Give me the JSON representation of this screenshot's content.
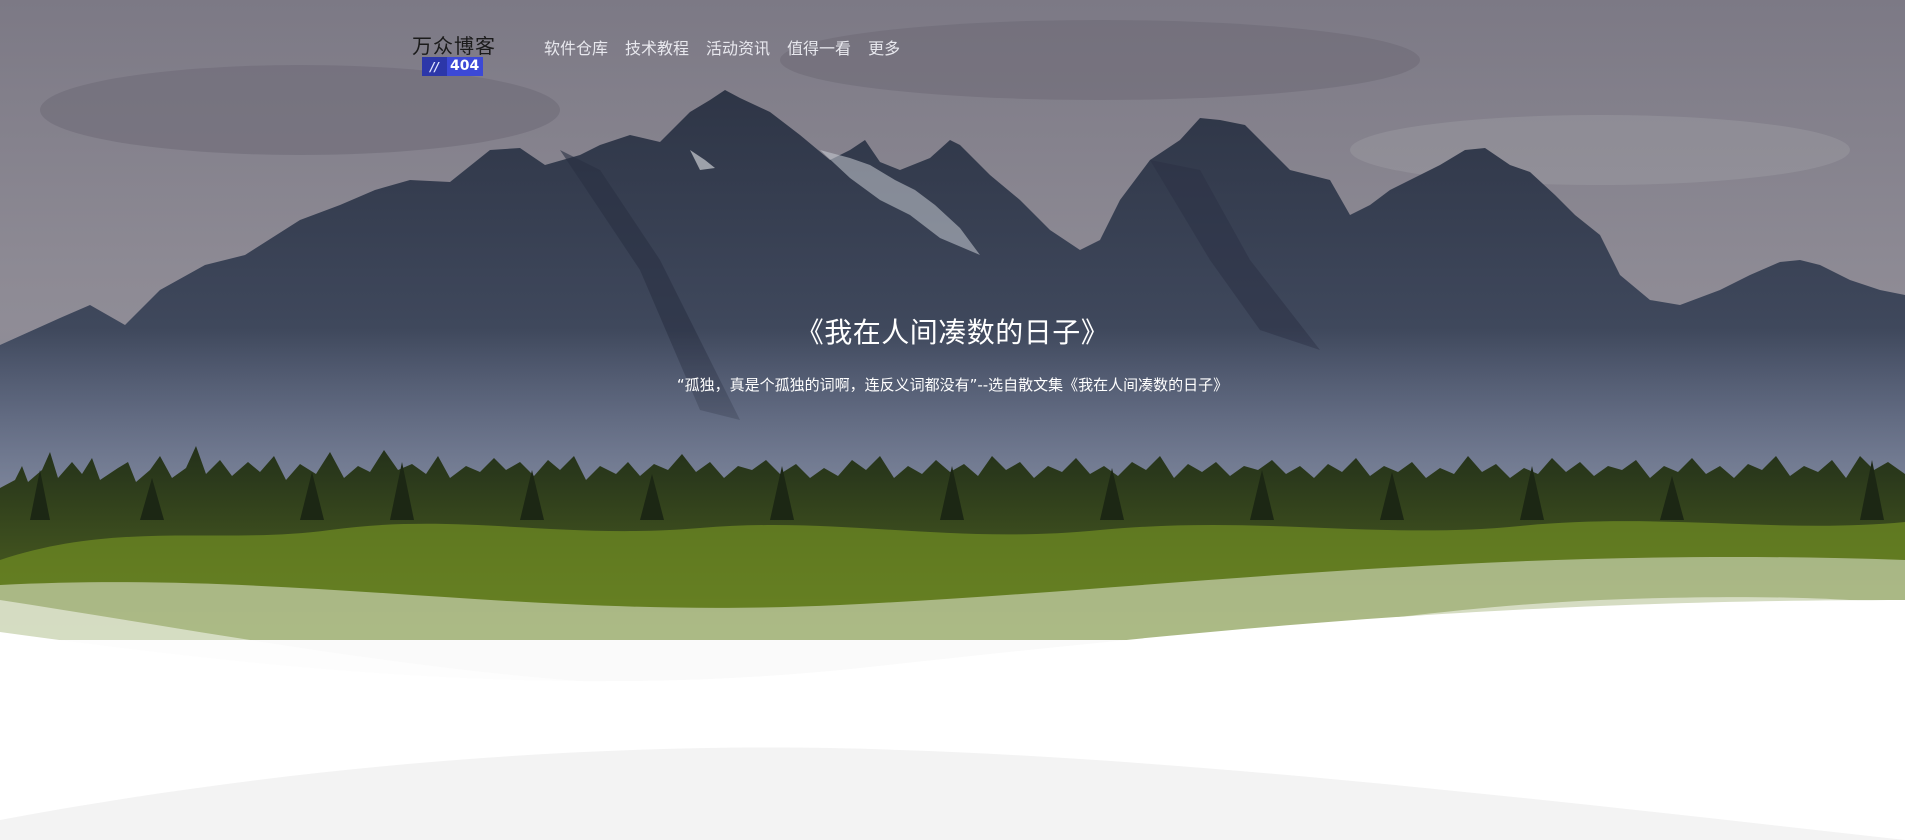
{
  "site": {
    "logo_title": "万众博客",
    "logo_badge_slash": "//",
    "logo_badge_code": "404"
  },
  "nav": {
    "items": [
      {
        "label": "软件仓库"
      },
      {
        "label": "技术教程"
      },
      {
        "label": "活动资讯"
      },
      {
        "label": "值得一看"
      },
      {
        "label": "更多"
      }
    ]
  },
  "hero": {
    "headline": "《我在人间凑数的日子》",
    "quote": "“孤独，真是个孤独的词啊，连反义词都没有”--选自散文集《我在人间凑数的日子》"
  },
  "colors": {
    "sky": "#7f7c88",
    "mountain": "#3e4658",
    "forest": "#3a4b1c",
    "wave": "#ffffff",
    "badge": "#3c49d6"
  }
}
